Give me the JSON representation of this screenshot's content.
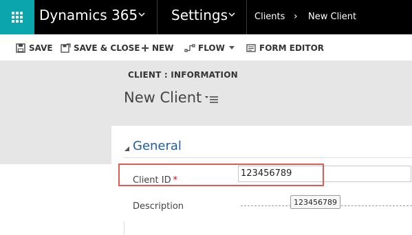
{
  "topbar": {
    "app_name": "Dynamics 365",
    "area": "Settings",
    "breadcrumb": [
      "Clients",
      "New Client"
    ]
  },
  "commands": {
    "save": "SAVE",
    "save_close": "SAVE & CLOSE",
    "new": "NEW",
    "flow": "FLOW",
    "form_editor": "FORM EDITOR"
  },
  "form": {
    "entity_label": "CLIENT : INFORMATION",
    "record_title": "New Client",
    "section_title": "General",
    "fields": {
      "client_id": {
        "label": "Client ID",
        "required_marker": "*",
        "value": "123456789"
      },
      "description": {
        "label": "Description",
        "value": ""
      }
    },
    "tooltip": "123456789"
  },
  "colors": {
    "brand_teal": "#0aa5ad",
    "topbar": "#000000",
    "section_title": "#1f5d9c",
    "highlight": "#e05a4f",
    "required": "#cc0000"
  }
}
